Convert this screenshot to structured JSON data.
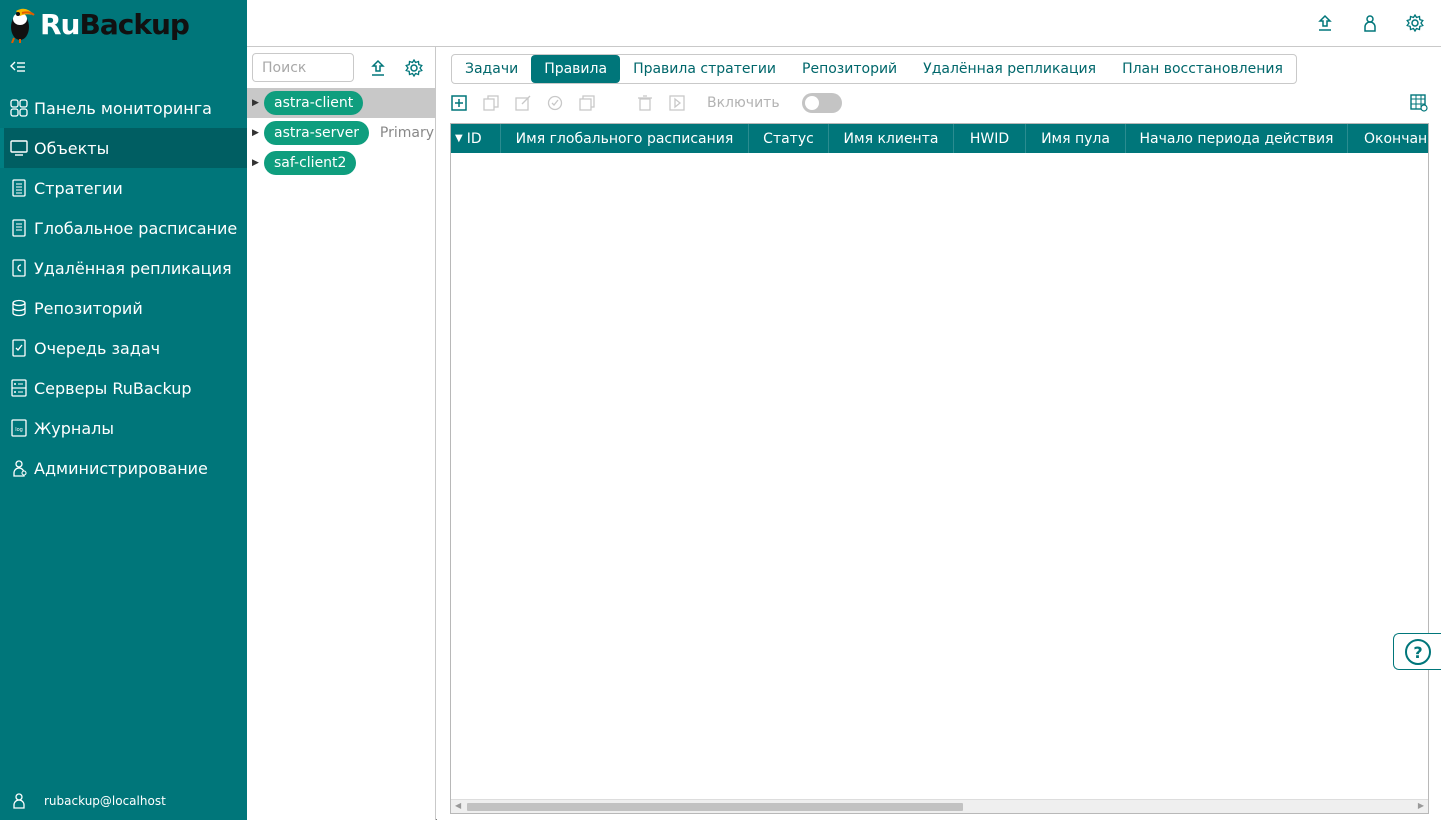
{
  "app": {
    "logo_ru": "Ru",
    "logo_backup": "Backup",
    "accent_color": "#00767a"
  },
  "sidebar": {
    "collapse_icon": "collapse-menu-icon",
    "items": [
      {
        "label": "Панель мониторинга",
        "icon": "dashboard-icon",
        "active": false
      },
      {
        "label": "Объекты",
        "icon": "monitor-icon",
        "active": true
      },
      {
        "label": "Стратегии",
        "icon": "document-list-icon",
        "active": false
      },
      {
        "label": "Глобальное расписание",
        "icon": "document-icon",
        "active": false
      },
      {
        "label": "Удалённая репликация",
        "icon": "replication-icon",
        "active": false
      },
      {
        "label": "Репозиторий",
        "icon": "database-icon",
        "active": false
      },
      {
        "label": "Очередь задач",
        "icon": "checklist-icon",
        "active": false
      },
      {
        "label": "Серверы RuBackup",
        "icon": "server-icon",
        "active": false
      },
      {
        "label": "Журналы",
        "icon": "log-icon",
        "active": false
      },
      {
        "label": "Администрирование",
        "icon": "admin-user-icon",
        "active": false
      }
    ],
    "user": "rubackup@localhost"
  },
  "topbar": {
    "icons": [
      "upload-icon",
      "user-icon",
      "settings-icon"
    ]
  },
  "tree": {
    "search_placeholder": "Поиск",
    "clients": [
      {
        "name": "astra-client",
        "extra": "",
        "selected": true
      },
      {
        "name": "astra-server",
        "extra": "Primary",
        "selected": false
      },
      {
        "name": "saf-client2",
        "extra": "",
        "selected": false
      }
    ]
  },
  "tabs": [
    {
      "label": "Задачи",
      "active": false
    },
    {
      "label": "Правила",
      "active": true
    },
    {
      "label": "Правила стратегии",
      "active": false
    },
    {
      "label": "Репозиторий",
      "active": false
    },
    {
      "label": "Удалённая репликация",
      "active": false
    },
    {
      "label": "План восстановления",
      "active": false
    }
  ],
  "toolbar": {
    "enable_label": "Включить",
    "enable_state": false
  },
  "table": {
    "sort_indicator": "▼",
    "columns": [
      "ID",
      "Имя глобального расписания",
      "Статус",
      "Имя клиента",
      "HWID",
      "Имя пула",
      "Начало периода действия",
      "Окончание"
    ],
    "rows": []
  },
  "help_label": "?"
}
